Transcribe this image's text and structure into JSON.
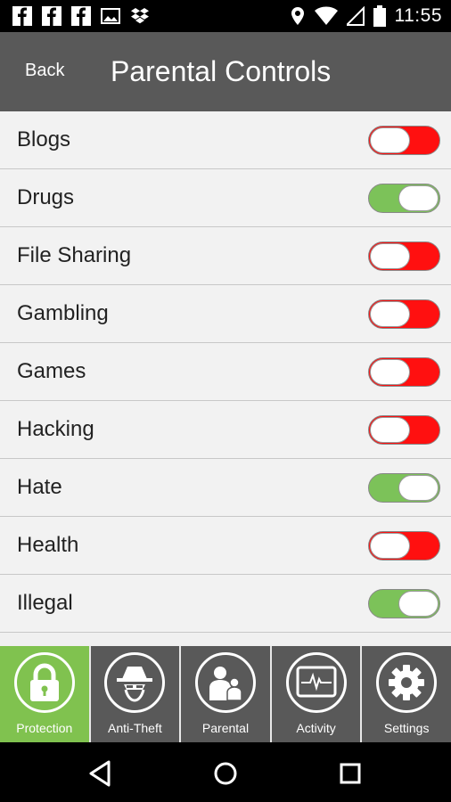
{
  "status_bar": {
    "time": "11:55",
    "notification_icons": [
      "facebook-icon",
      "facebook-icon",
      "facebook-icon",
      "image-icon",
      "dropbox-icon"
    ],
    "system_icons": [
      "location-icon",
      "wifi-icon",
      "signal-icon",
      "battery-icon"
    ]
  },
  "header": {
    "back_label": "Back",
    "title": "Parental Controls"
  },
  "categories": [
    {
      "label": "Blogs",
      "enabled": false
    },
    {
      "label": "Drugs",
      "enabled": true
    },
    {
      "label": "File Sharing",
      "enabled": false
    },
    {
      "label": "Gambling",
      "enabled": false
    },
    {
      "label": "Games",
      "enabled": false
    },
    {
      "label": "Hacking",
      "enabled": false
    },
    {
      "label": "Hate",
      "enabled": true
    },
    {
      "label": "Health",
      "enabled": false
    },
    {
      "label": "Illegal",
      "enabled": true
    }
  ],
  "tabs": [
    {
      "label": "Protection",
      "icon": "lock-icon",
      "active": true
    },
    {
      "label": "Anti-Theft",
      "icon": "spy-icon",
      "active": false
    },
    {
      "label": "Parental",
      "icon": "parent-child-icon",
      "active": false
    },
    {
      "label": "Activity",
      "icon": "heartbeat-monitor-icon",
      "active": false
    },
    {
      "label": "Settings",
      "icon": "gear-icon",
      "active": false
    }
  ],
  "colors": {
    "header_bg": "#595959",
    "toggle_on": "#7cc259",
    "toggle_off": "#ff1010",
    "active_tab": "#80c24f"
  }
}
